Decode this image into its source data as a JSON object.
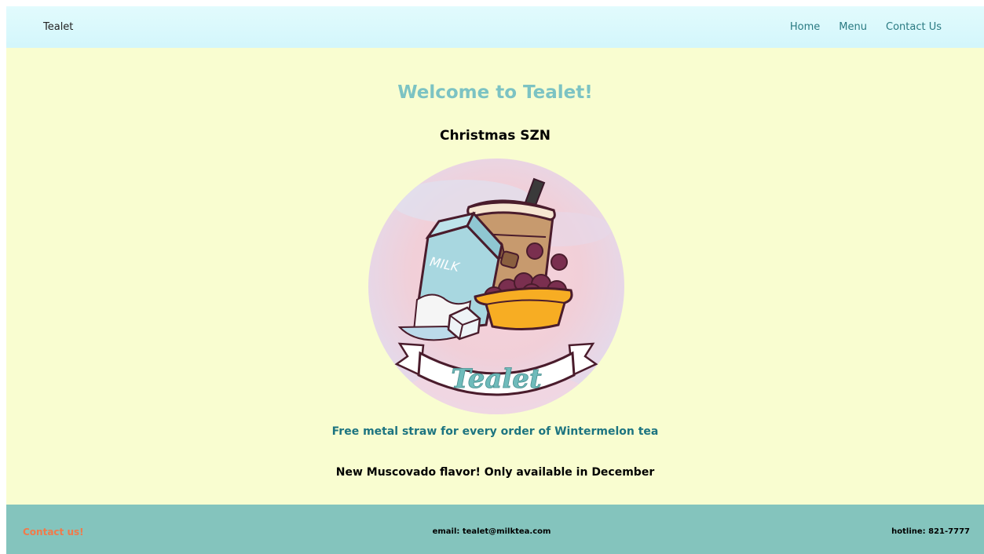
{
  "navbar": {
    "brand": "Tealet",
    "links": [
      {
        "label": "Home"
      },
      {
        "label": "Menu"
      },
      {
        "label": "Contact Us"
      }
    ]
  },
  "main": {
    "welcome": "Welcome to Tealet!",
    "season": "Christmas SZN",
    "logo": {
      "milk_label": "MILK",
      "banner_text": "Tealet"
    },
    "promo_straw": "Free metal straw for every order of Wintermelon tea",
    "promo_flavor": "New Muscovado flavor! Only available in December"
  },
  "footer": {
    "contact": "Contact us!",
    "email": "email: tealet@milktea.com",
    "hotline": "hotline: 821-7777"
  },
  "colors": {
    "nav_bg": "#d8f8fc",
    "main_bg": "#f9fdd0",
    "welcome": "#7cc3c3",
    "promo_teal": "#1d7480",
    "footer_bg": "#84c4bd",
    "footer_contact": "#f07a4a"
  }
}
